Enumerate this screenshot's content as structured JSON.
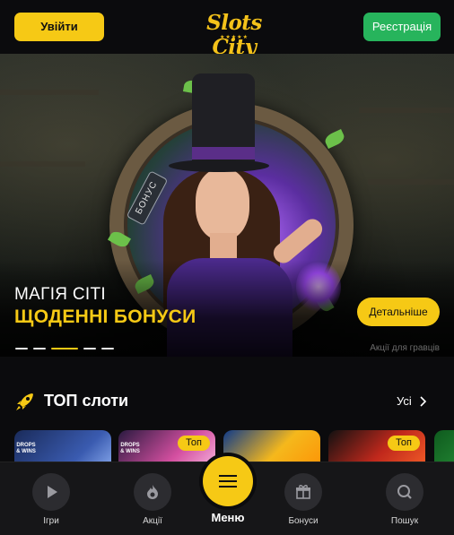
{
  "header": {
    "login_label": "Увійти",
    "register_label": "Реєстрація",
    "logo_text": "Slots City",
    "logo_stars": "★★★★★"
  },
  "banner": {
    "tag": "БОНУС",
    "subtitle": "МАГІЯ СІТІ",
    "title": "ЩОДЕННІ БОНУСИ",
    "details_label": "Детальніше",
    "caption": "Акції для гравців",
    "slides_count": 5,
    "active_slide": 3
  },
  "top_slots": {
    "title": "ТОП слоти",
    "see_all_label": "Усі",
    "tiles": [
      {
        "badge": "",
        "logo": "DROPS & WINS"
      },
      {
        "badge": "Топ",
        "logo": "DROPS & WINS"
      },
      {
        "badge": "",
        "logo": ""
      },
      {
        "badge": "Топ",
        "logo": ""
      },
      {
        "badge": "",
        "logo": ""
      }
    ]
  },
  "bottom_nav": {
    "items": [
      {
        "label": "Ігри",
        "icon": "play-icon"
      },
      {
        "label": "Акції",
        "icon": "fire-icon"
      },
      {
        "label": "Бонуси",
        "icon": "gift-icon"
      },
      {
        "label": "Пошук",
        "icon": "search-icon"
      }
    ],
    "menu_label": "Меню"
  },
  "colors": {
    "accent": "#f6c915",
    "register": "#27b45c",
    "background": "#0b0b0d"
  }
}
